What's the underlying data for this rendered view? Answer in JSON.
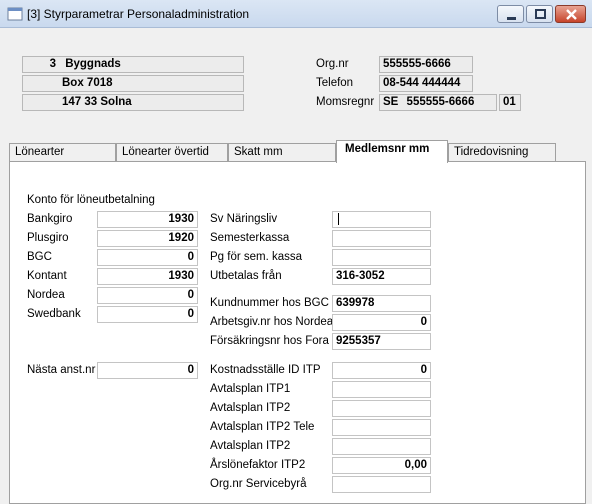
{
  "window": {
    "title": "[3]  Styrparametrar Personaladministration"
  },
  "header": {
    "company_number": "3",
    "company_name": "Byggnads",
    "address": "Box 7018",
    "postal": "147 33 Solna",
    "orgnr_label": "Org.nr",
    "orgnr_value": "555555-6666",
    "phone_label": "Telefon",
    "phone_value": "08-544 444444",
    "vat_label": "Momsregnr",
    "vat_country": "SE",
    "vat_value": "555555-6666",
    "vat_suffix": "01"
  },
  "tabs": [
    {
      "label": "Lönearter"
    },
    {
      "label": "Lönearter övertid"
    },
    {
      "label": "Skatt mm"
    },
    {
      "label": "Medlemsnr mm",
      "active": true
    },
    {
      "label": "Tidredovisning"
    }
  ],
  "left": {
    "section_title": "Konto för löneutbetalning",
    "fields": [
      {
        "label": "Bankgiro",
        "value": "1930"
      },
      {
        "label": "Plusgiro",
        "value": "1920"
      },
      {
        "label": "BGC",
        "value": "0"
      },
      {
        "label": "Kontant",
        "value": "1930"
      },
      {
        "label": "Nordea",
        "value": "0"
      },
      {
        "label": "Swedbank",
        "value": "0"
      }
    ],
    "next_emp_label": "Nästa anst.nr",
    "next_emp_value": "0"
  },
  "right": {
    "fields": [
      {
        "label": "Sv Näringsliv",
        "value": ""
      },
      {
        "label": "Semesterkassa",
        "value": ""
      },
      {
        "label": "Pg för sem. kassa",
        "value": ""
      },
      {
        "label": "Utbetalas från",
        "value": "316-3052"
      },
      {
        "label": "Kundnummer hos BGC",
        "value": "639978"
      },
      {
        "label": "Arbetsgiv.nr hos Nordea",
        "value": "0"
      },
      {
        "label": "Försäkringsnr hos Fora",
        "value": "9255357"
      },
      {
        "label": "Kostnadsställe ID ITP",
        "value": "0"
      },
      {
        "label": "Avtalsplan ITP1",
        "value": ""
      },
      {
        "label": "Avtalsplan ITP2",
        "value": ""
      },
      {
        "label": "Avtalsplan ITP2 Tele",
        "value": ""
      },
      {
        "label": "Avtalsplan ITP2",
        "value": ""
      },
      {
        "label": "Årslönefaktor ITP2",
        "value": "0,00"
      },
      {
        "label": "Org.nr Servicebyrå",
        "value": ""
      }
    ]
  },
  "colors": {
    "titlebar": "#c9d9ee",
    "panel": "#ffffff",
    "background": "#f0f0f0",
    "close_button": "#c7442b"
  },
  "icons": [
    "app-icon",
    "minimize-icon",
    "maximize-icon",
    "close-icon"
  ]
}
